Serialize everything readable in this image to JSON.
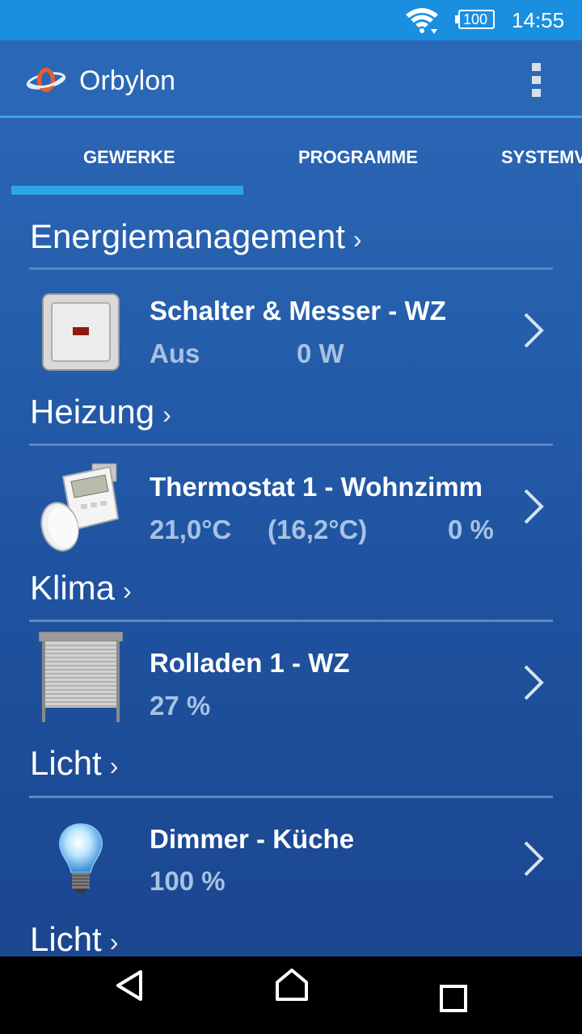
{
  "status_bar": {
    "battery": "100",
    "time": "14:55"
  },
  "app": {
    "title": "Orbylon"
  },
  "tabs": [
    {
      "label": "GEWERKE",
      "active": true
    },
    {
      "label": "PROGRAMME",
      "active": false
    },
    {
      "label": "SYSTEMV",
      "active": false
    }
  ],
  "sections": [
    {
      "title": "Energiemanagement",
      "device": {
        "icon": "wall-switch-icon",
        "name": "Schalter & Messer - WZ",
        "values": [
          "Aus",
          "0 W"
        ]
      }
    },
    {
      "title": "Heizung",
      "device": {
        "icon": "thermostat-icon",
        "name": "Thermostat 1 - Wohnzimm",
        "values": [
          "21,0°C",
          "(16,2°C)",
          "0 %"
        ]
      }
    },
    {
      "title": "Klima",
      "device": {
        "icon": "roller-shutter-icon",
        "name": "Rolladen 1 - WZ",
        "values": [
          "27 %"
        ]
      }
    },
    {
      "title": "Licht",
      "device": {
        "icon": "light-bulb-icon",
        "name": "Dimmer - Küche",
        "values": [
          "100 %"
        ]
      }
    },
    {
      "title": "Licht"
    }
  ],
  "colors": {
    "status_bar": "#1a8fe0",
    "app_bar": "#2a68b6",
    "accent": "#2ea6e6",
    "value_text": "#a8c2e4"
  },
  "nav_bar": {
    "icons": [
      "back-icon",
      "home-icon",
      "recents-icon"
    ]
  }
}
